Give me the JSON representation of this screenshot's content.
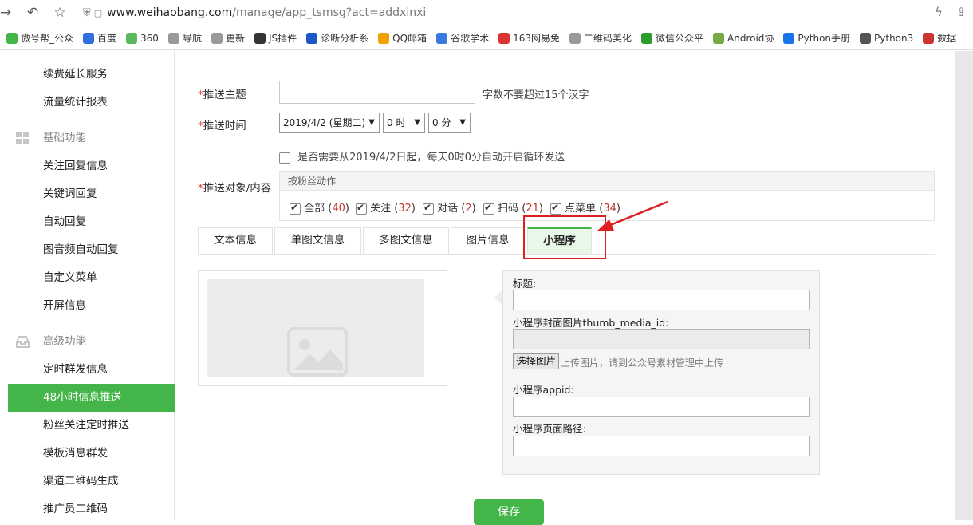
{
  "browser": {
    "url_host": "www.weihaobang.com",
    "url_path": "/manage/app_tsmsg?act=addxinxi",
    "bookmarks": [
      "微号帮_公众",
      "百度",
      "360",
      "导航",
      "更新",
      "JS插件",
      "诊断分析系",
      "QQ邮箱",
      "谷歌学术",
      "163网易免",
      "二维码美化",
      "微信公众平",
      "Android协",
      "Python手册",
      "Python3",
      "数据"
    ]
  },
  "sidebar": {
    "items_top": [
      "续费延长服务",
      "流量统计报表"
    ],
    "group_basic": "基础功能",
    "items_basic": [
      "关注回复信息",
      "关键词回复",
      "自动回复",
      "图音频自动回复",
      "自定义菜单",
      "开屏信息"
    ],
    "group_advanced": "高级功能",
    "items_advanced": [
      "定时群发信息",
      "48小时信息推送",
      "粉丝关注定时推送",
      "模板消息群发",
      "渠道二维码生成",
      "推广员二维码"
    ],
    "active_item": "48小时信息推送"
  },
  "form": {
    "topic_label": "推送主题",
    "topic_value": "",
    "topic_hint": "字数不要超过15个汉字",
    "time_label": "推送时间",
    "date_value": "2019/4/2 (星期二)",
    "hour_value": "0 时",
    "minute_value": "0 分",
    "loop_label": "是否需要从2019/4/2日起，每天0时0分自动开启循环发送",
    "audience_label": "推送对象/内容",
    "audience_header": "按粉丝动作",
    "audience": [
      {
        "name": "全部",
        "count": "40"
      },
      {
        "name": "关注",
        "count": "32"
      },
      {
        "name": "对话",
        "count": "2"
      },
      {
        "name": "扫码",
        "count": "21"
      },
      {
        "name": "点菜单",
        "count": "34"
      }
    ]
  },
  "tabs": [
    "文本信息",
    "单图文信息",
    "多图文信息",
    "图片信息",
    "小程序"
  ],
  "active_tab": "小程序",
  "miniprogram": {
    "title_label": "标题:",
    "thumb_label": "小程序封面图片thumb_media_id:",
    "pick_button": "选择图片",
    "pick_hint": "上传图片，请到公众号素材管理中上传",
    "appid_label": "小程序appid:",
    "path_label": "小程序页面路径:"
  },
  "save_button": "保存",
  "colors": {
    "accent": "#44b549",
    "highlight": "#e02020"
  }
}
